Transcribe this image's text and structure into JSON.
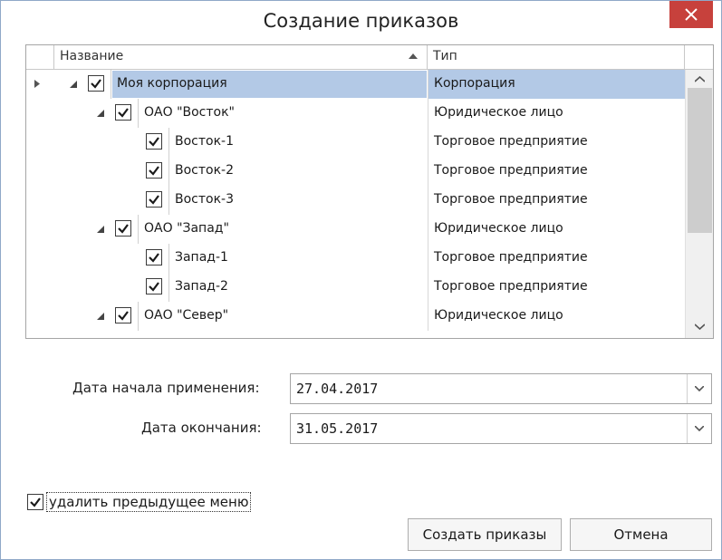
{
  "window": {
    "title": "Создание приказов"
  },
  "grid": {
    "columns": {
      "name": "Название",
      "type": "Тип"
    },
    "rows": [
      {
        "name": "Моя корпорация",
        "type": "Корпорация",
        "checked": true,
        "selected": true
      },
      {
        "name": "ОАО \"Восток\"",
        "type": "Юридическое лицо",
        "checked": true
      },
      {
        "name": "Восток-1",
        "type": "Торговое предприятие",
        "checked": true
      },
      {
        "name": "Восток-2",
        "type": "Торговое предприятие",
        "checked": true
      },
      {
        "name": "Восток-3",
        "type": "Торговое предприятие",
        "checked": true
      },
      {
        "name": "ОАО \"Запад\"",
        "type": "Юридическое лицо",
        "checked": true
      },
      {
        "name": "Запад-1",
        "type": "Торговое предприятие",
        "checked": true
      },
      {
        "name": "Запад-2",
        "type": "Торговое предприятие",
        "checked": true
      },
      {
        "name": "ОАО \"Север\"",
        "type": "Юридическое лицо",
        "checked": true
      }
    ]
  },
  "form": {
    "start_label": "Дата начала применения:",
    "start_value": "27.04.2017",
    "end_label": "Дата окончания:",
    "end_value": "31.05.2017",
    "delete_prev_label": "удалить предыдущее меню",
    "delete_prev_checked": true
  },
  "buttons": {
    "create": "Создать приказы",
    "cancel": "Отмена"
  },
  "colors": {
    "selection": "#b3c9e6",
    "close": "#c7413c"
  }
}
